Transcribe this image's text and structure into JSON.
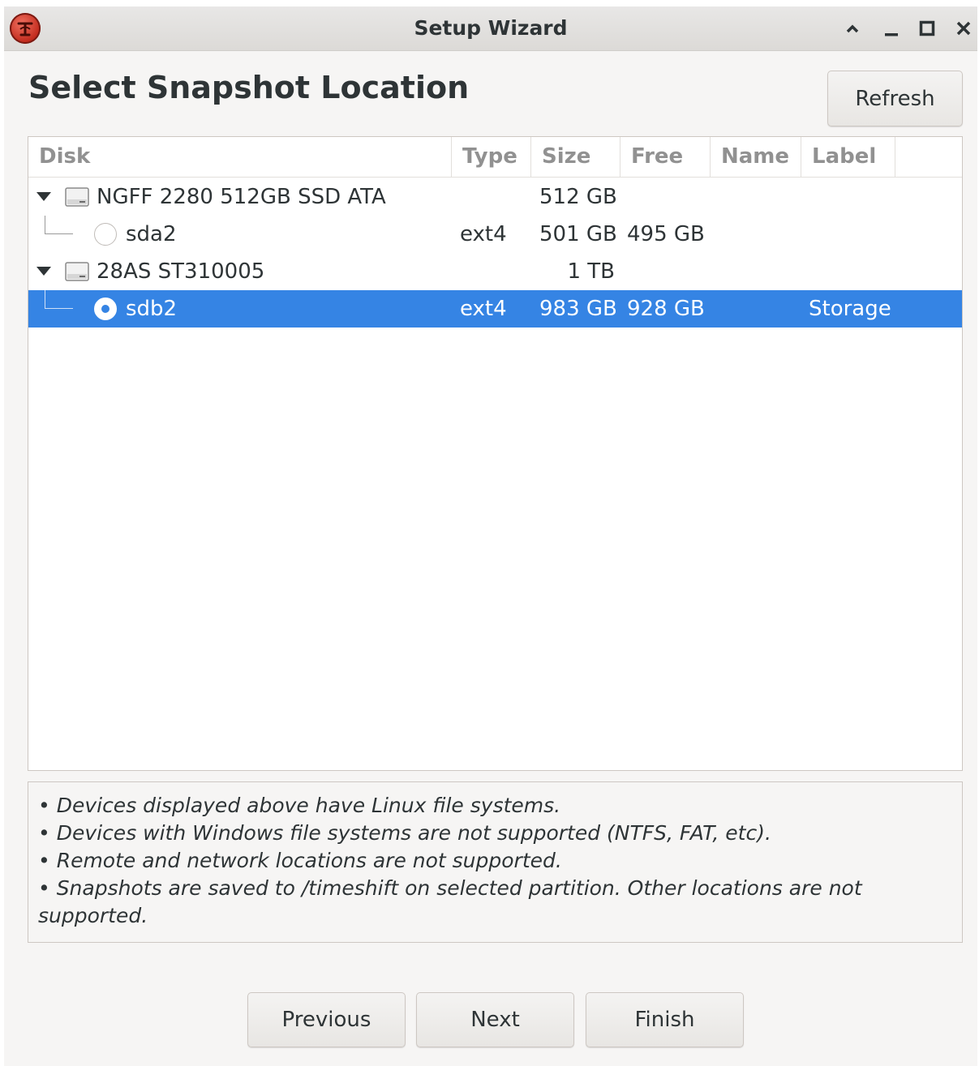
{
  "window": {
    "title": "Setup Wizard"
  },
  "page": {
    "heading": "Select Snapshot Location",
    "refresh_label": "Refresh"
  },
  "tree": {
    "columns": [
      "Disk",
      "Type",
      "Size",
      "Free",
      "Name",
      "Label"
    ],
    "rows": [
      {
        "kind": "disk",
        "disk": "NGFF 2280 512GB SSD ATA",
        "type": "",
        "size": "512 GB",
        "free": "",
        "name": "",
        "label": ""
      },
      {
        "kind": "partition",
        "disk": "sda2",
        "type": "ext4",
        "size": "501 GB",
        "free": "495 GB",
        "name": "",
        "label": "",
        "selected": false
      },
      {
        "kind": "disk",
        "disk": "28AS ST310005",
        "type": "",
        "size": "1 TB",
        "free": "",
        "name": "",
        "label": ""
      },
      {
        "kind": "partition",
        "disk": "sdb2",
        "type": "ext4",
        "size": "983 GB",
        "free": "928 GB",
        "name": "",
        "label": "Storage",
        "selected": true
      }
    ]
  },
  "info": {
    "lines": [
      "• Devices displayed above have Linux file systems.",
      "• Devices with Windows file systems are not supported (NTFS, FAT, etc).",
      "• Remote and network locations are not supported.",
      "• Snapshots are saved to /timeshift on selected partition. Other locations are not supported."
    ]
  },
  "footer": {
    "previous_label": "Previous",
    "next_label": "Next",
    "finish_label": "Finish"
  },
  "colors": {
    "selection": "#3584e4",
    "app_icon": "#c0281a"
  },
  "icons": {
    "app": "timeshift-icon",
    "disk": "harddisk-icon",
    "window_controls": [
      "chevron-up-icon",
      "minimize-icon",
      "maximize-icon",
      "close-icon"
    ]
  }
}
